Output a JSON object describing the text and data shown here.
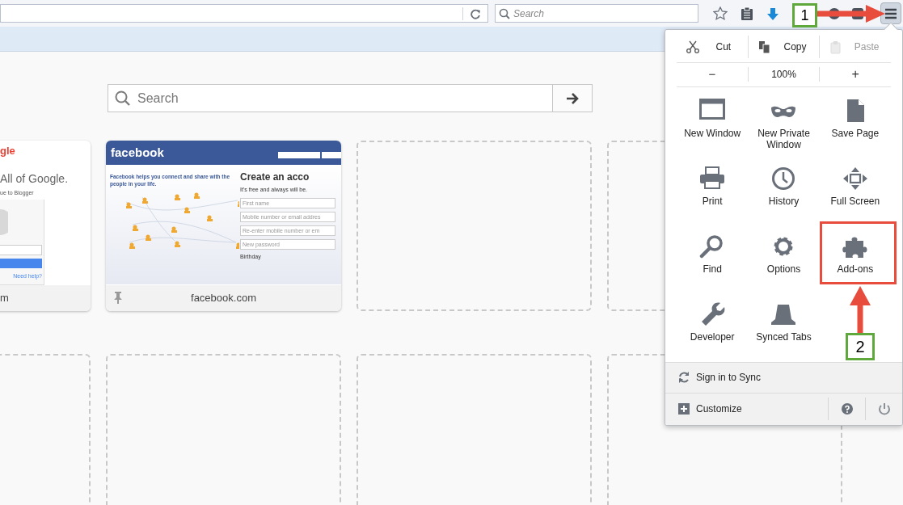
{
  "toolbar": {
    "search": {
      "placeholder": "Search"
    }
  },
  "new_tab": {
    "search": {
      "placeholder": "Search"
    },
    "tiles": [
      {
        "kind": "google",
        "label": "m",
        "texts": [
          "gle",
          "All of Google.",
          "ue to Blogger",
          "Need help?"
        ]
      },
      {
        "kind": "facebook",
        "label": "facebook.com",
        "pinned": true,
        "texts": [
          "facebook",
          "Facebook helps you connect and share with the people in your life.",
          "Create an acco",
          "It's free and always will be.",
          "First name",
          "Mobile number or email addres",
          "Re-enter mobile number or em",
          "New password",
          "Birthday"
        ]
      },
      {
        "kind": "empty"
      },
      {
        "kind": "empty"
      },
      {
        "kind": "empty"
      },
      {
        "kind": "empty"
      },
      {
        "kind": "empty"
      },
      {
        "kind": "empty"
      }
    ]
  },
  "menu": {
    "edit_row": [
      {
        "label": "Cut",
        "kind": "cut",
        "disabled": false
      },
      {
        "label": "Copy",
        "kind": "copy",
        "disabled": false
      },
      {
        "label": "Paste",
        "kind": "paste",
        "disabled": true
      }
    ],
    "zoom": {
      "out": "−",
      "level": "100%",
      "in": "+"
    },
    "items": [
      {
        "label": "New Window",
        "kind": "window"
      },
      {
        "label": "New Private Window",
        "kind": "mask"
      },
      {
        "label": "Save Page",
        "kind": "page"
      },
      {
        "label": "Print",
        "kind": "printer"
      },
      {
        "label": "History",
        "kind": "clock"
      },
      {
        "label": "Full Screen",
        "kind": "fullscreen"
      },
      {
        "label": "Find",
        "kind": "find"
      },
      {
        "label": "Options",
        "kind": "gear"
      },
      {
        "label": "Add-ons",
        "kind": "puzzle"
      },
      {
        "label": "Developer",
        "kind": "wrench"
      },
      {
        "label": "Synced Tabs",
        "kind": "synced"
      }
    ],
    "sign_in": "Sign in to Sync",
    "customize": "Customize"
  },
  "annotations": [
    {
      "label": "1"
    },
    {
      "label": "2"
    }
  ]
}
